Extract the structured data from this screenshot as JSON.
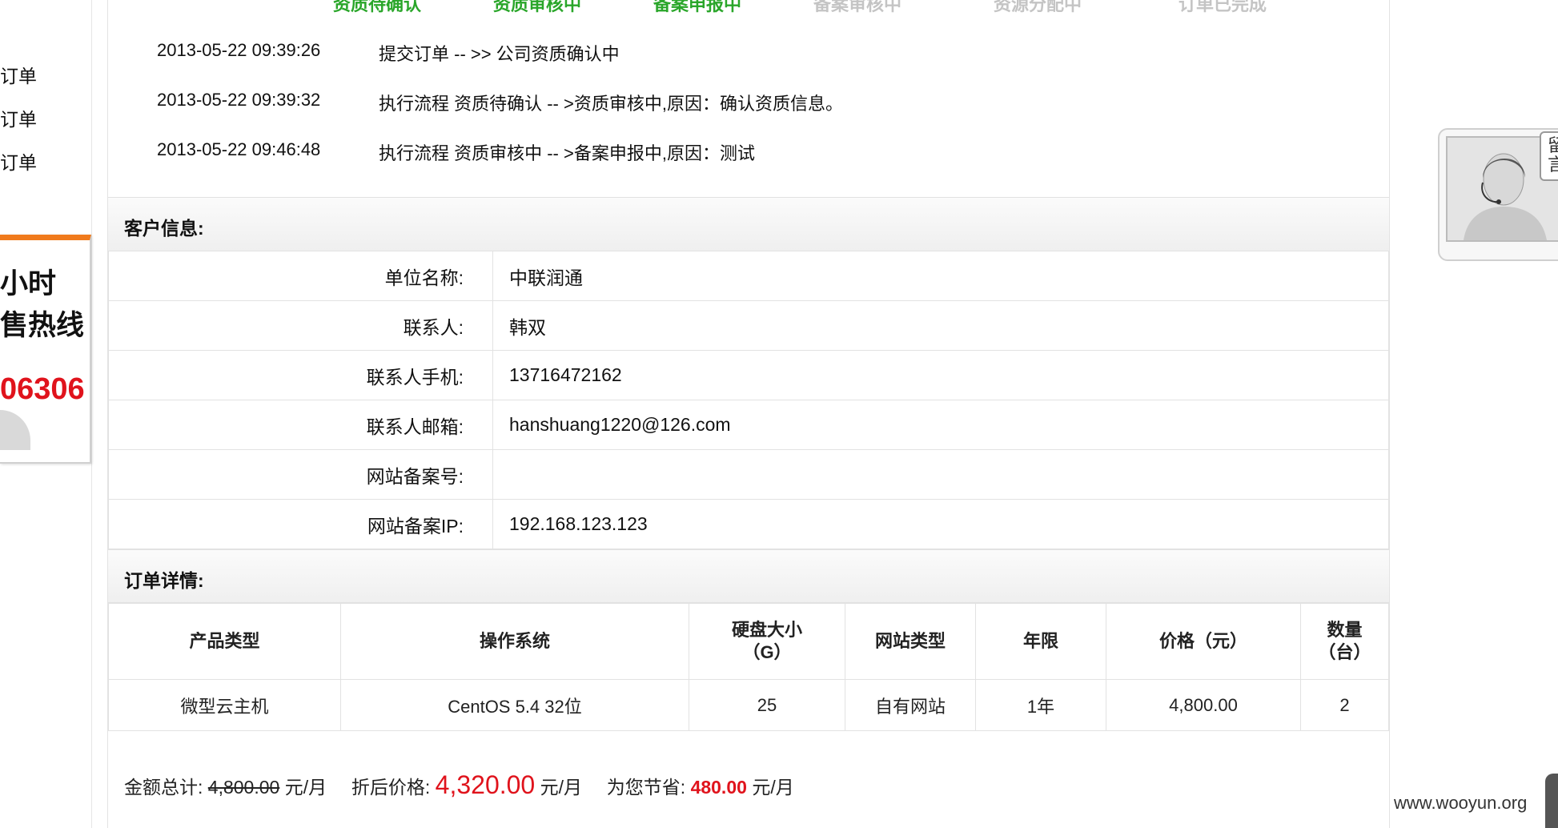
{
  "sidebar": {
    "links": [
      "订单",
      "订单",
      "订单"
    ],
    "hotline": {
      "line1": "小时",
      "line2": "售热线",
      "number": "06306"
    }
  },
  "steps": [
    {
      "label": "资质待确认",
      "state": "done"
    },
    {
      "label": "资质审核中",
      "state": "done"
    },
    {
      "label": "备案申报中",
      "state": "done"
    },
    {
      "label": "备案审核中",
      "state": "todo"
    },
    {
      "label": "资源分配中",
      "state": "todo"
    },
    {
      "label": "订单已完成",
      "state": "todo"
    }
  ],
  "log": [
    {
      "time": "2013-05-22 09:39:26",
      "message": "提交订单 -- >> 公司资质确认中"
    },
    {
      "time": "2013-05-22 09:39:32",
      "message": "执行流程 资质待确认 -- >资质审核中,原因：确认资质信息。"
    },
    {
      "time": "2013-05-22 09:46:48",
      "message": "执行流程 资质审核中 -- >备案申报中,原因：测试"
    }
  ],
  "customer": {
    "title": "客户信息:",
    "fields": [
      {
        "label": "单位名称:",
        "value": "中联润通"
      },
      {
        "label": "联系人:",
        "value": "韩双"
      },
      {
        "label": "联系人手机:",
        "value": "13716472162"
      },
      {
        "label": "联系人邮箱:",
        "value": "hanshuang1220@126.com"
      },
      {
        "label": "网站备案号:",
        "value": ""
      },
      {
        "label": "网站备案IP:",
        "value": "192.168.123.123"
      }
    ]
  },
  "order": {
    "title": "订单详情:",
    "headers": [
      "产品类型",
      "操作系统",
      "硬盘大小\n（G）",
      "网站类型",
      "年限",
      "价格（元）",
      "数量\n（台）"
    ],
    "row": [
      "微型云主机",
      "CentOS 5.4 32位",
      "25",
      "自有网站",
      "1年",
      "4,800.00",
      "2"
    ]
  },
  "totals": {
    "total_label": "金额总计:",
    "total_value": "4,800.00",
    "unit": "元/月",
    "discount_label": "折后价格:",
    "discount_value": "4,320.00",
    "save_label": "为您节省:",
    "save_value": "480.00"
  },
  "cs_widget": {
    "tab_text": "留言"
  },
  "watermark": "www.wooyun.org",
  "colors": {
    "accent_green": "#2aa62a",
    "price_red": "#e0131c",
    "hotline_orange": "#f07a1c"
  }
}
